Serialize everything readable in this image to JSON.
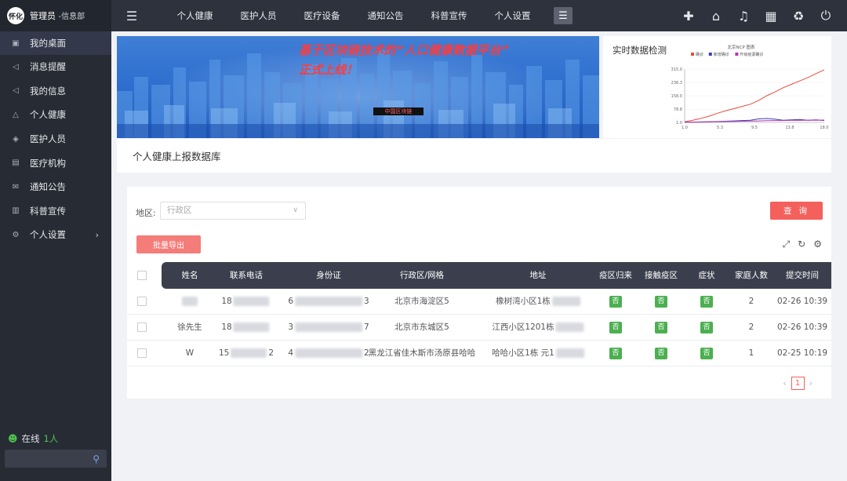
{
  "brand": {
    "logo": "怀化",
    "name": "管理员",
    "role": "-信息部"
  },
  "sidebar": {
    "items": [
      {
        "label": "我的桌面",
        "icon": "monitor-icon",
        "glyph": "▣"
      },
      {
        "label": "消息提醒",
        "icon": "speaker-icon",
        "glyph": "◁"
      },
      {
        "label": "我的信息",
        "icon": "speaker-icon",
        "glyph": "◁"
      },
      {
        "label": "个人健康",
        "icon": "triangle-icon",
        "glyph": "△"
      },
      {
        "label": "医护人员",
        "icon": "layers-icon",
        "glyph": "◈"
      },
      {
        "label": "医疗机构",
        "icon": "document-icon",
        "glyph": "▤"
      },
      {
        "label": "通知公告",
        "icon": "mail-icon",
        "glyph": "✉"
      },
      {
        "label": "科普宣传",
        "icon": "book-icon",
        "glyph": "▥"
      },
      {
        "label": "个人设置",
        "icon": "gear-icon",
        "glyph": "⚙"
      }
    ],
    "online_label": "在线",
    "online_count": "1人"
  },
  "topnav": [
    "个人健康",
    "医护人员",
    "医疗设备",
    "通知公告",
    "科普宣传",
    "个人设置"
  ],
  "banner": {
    "line1": "基于区块链技术的“人口健康数据平台”",
    "line2": "正式上线！",
    "button": "中国区块链"
  },
  "realtime": {
    "title": "实时数据检测",
    "chart_title": "北京NCP 图表",
    "legend": [
      "确诊",
      "新增确诊",
      "升级疫源确诊"
    ],
    "colors": [
      "#e74c3c",
      "#3b3fb5",
      "#b03ab0"
    ],
    "yticks": [
      "315.0",
      "236.3",
      "158.0",
      "78.8",
      "1.0"
    ],
    "xticks": [
      "1.0",
      "5.3",
      "9.5",
      "13.8",
      "18.0"
    ]
  },
  "chart_data": {
    "type": "line",
    "title": "北京NCP 图表",
    "xlabel": "",
    "ylabel": "",
    "x": [
      1,
      2,
      3,
      4,
      5,
      6,
      7,
      8,
      9,
      10,
      11,
      12,
      13,
      14,
      15,
      16,
      17,
      18
    ],
    "ylim": [
      1,
      315
    ],
    "xlim": [
      1,
      18
    ],
    "series": [
      {
        "name": "确诊",
        "values": [
          5,
          14,
          25,
          38,
          55,
          70,
          82,
          95,
          108,
          130,
          158,
          180,
          205,
          225,
          245,
          265,
          288,
          310
        ]
      },
      {
        "name": "新增确诊",
        "values": [
          2,
          3,
          4,
          5,
          6,
          8,
          10,
          12,
          14,
          22,
          24,
          20,
          14,
          16,
          18,
          14,
          16,
          12
        ]
      },
      {
        "name": "升级疫源确诊",
        "values": [
          1,
          2,
          3,
          4,
          5,
          6,
          7,
          8,
          9,
          10,
          11,
          12,
          12,
          13,
          13,
          14,
          14,
          15
        ]
      }
    ]
  },
  "db_title": "个人健康上报数据库",
  "filter": {
    "label": "地区:",
    "placeholder": "行政区",
    "query": "查 询"
  },
  "export": "批量导出",
  "table": {
    "headers": [
      "姓名",
      "联系电话",
      "身份证",
      "行政区/网格",
      "地址",
      "疫区归来",
      "接触疫区",
      "症状",
      "家庭人数",
      "提交时间"
    ],
    "rows": [
      {
        "name": "",
        "phone": "18",
        "phone_end": "",
        "id": "6",
        "id_end": "3",
        "district": "北京市海淀区5",
        "address": "橡树湾小区1栋",
        "r1": "否",
        "r2": "否",
        "r3": "否",
        "family": "2",
        "time": "02-26 10:39"
      },
      {
        "name": "徐先生",
        "phone": "18",
        "phone_end": "",
        "id": "3",
        "id_end": "7",
        "district": "北京市东城区5",
        "address": "江西小区1201栋",
        "r1": "否",
        "r2": "否",
        "r3": "否",
        "family": "2",
        "time": "02-26 10:39"
      },
      {
        "name": "W",
        "phone": "15",
        "phone_end": "2",
        "id": "4",
        "id_end": "2",
        "district": "黑龙江省佳木斯市汤原县哈哈",
        "address": "哈哈小区1栋 元1",
        "r1": "否",
        "r2": "否",
        "r3": "否",
        "family": "1",
        "time": "02-25 10:19"
      }
    ]
  },
  "pager": {
    "current": "1"
  }
}
